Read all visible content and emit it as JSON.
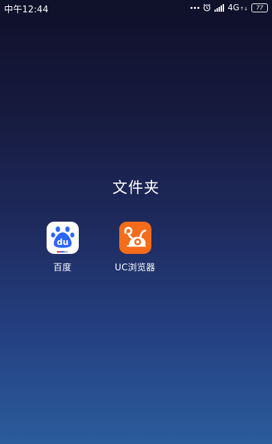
{
  "status_bar": {
    "time": "中午12:44",
    "network_type": "4G",
    "network_arrows": "↑↓",
    "battery_level": "77"
  },
  "folder": {
    "title": "文件夹"
  },
  "apps": [
    {
      "label": "百度",
      "icon": "baidu-paw-icon",
      "color": "#3385ff"
    },
    {
      "label": "UC浏览器",
      "icon": "uc-squirrel-icon",
      "color": "#f56c1b"
    }
  ],
  "colors": {
    "background_top": "#0f1029",
    "background_bottom": "#2b5c9c"
  }
}
